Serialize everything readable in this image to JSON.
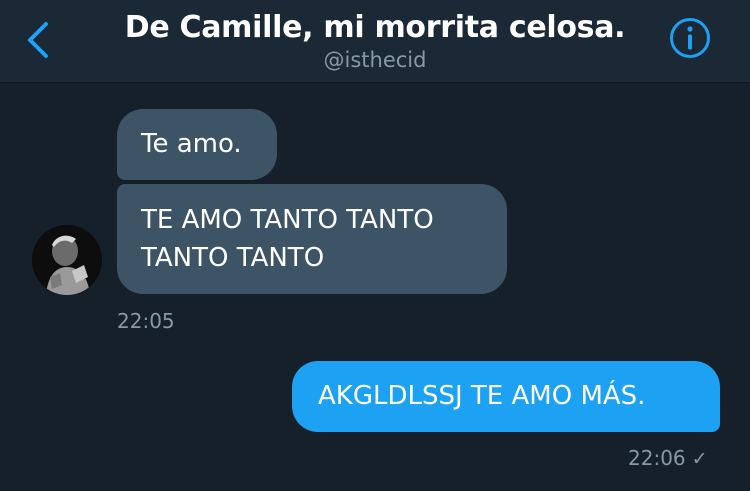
{
  "header": {
    "title": "De Camille, mi morrita celosa.",
    "handle": "@isthecid",
    "back_icon": "chevron-left-icon",
    "info_icon": "info-icon",
    "accent_color": "#1da1f2"
  },
  "messages": [
    {
      "direction": "incoming",
      "text": "Te amo."
    },
    {
      "direction": "incoming",
      "lines": [
        "TE AMO TANTO TANTO",
        "TANTO TANTO"
      ]
    },
    {
      "direction": "outgoing",
      "text": "AKGLDLSSJ TE AMO MÁS."
    }
  ],
  "timestamps": {
    "incoming": "22:05",
    "outgoing": "22:06",
    "outgoing_status_icon": "sent-check-icon"
  },
  "colors": {
    "background": "#15202b",
    "header": "#1b2836",
    "incoming_bubble": "#3d5466",
    "outgoing_bubble": "#1da1f2",
    "muted_text": "#8899a6"
  }
}
